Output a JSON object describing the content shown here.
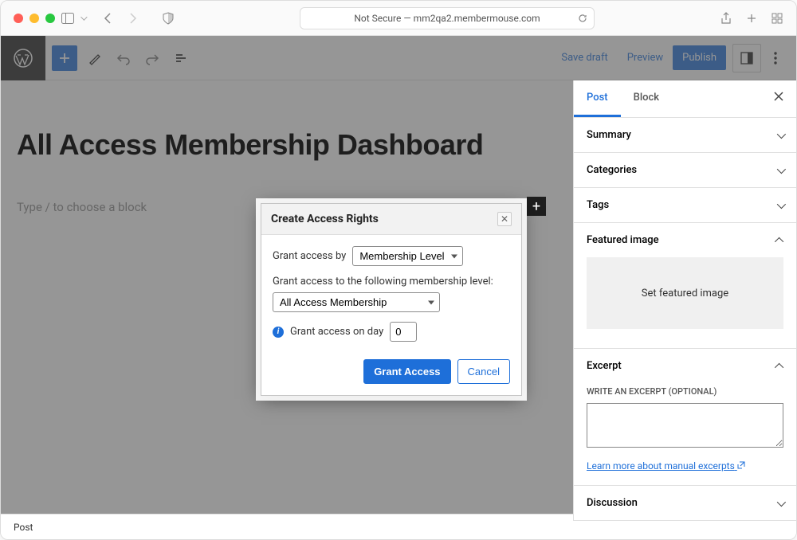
{
  "browser": {
    "url_label": "Not Secure — mm2qa2.membermouse.com"
  },
  "toolbar": {
    "save_draft": "Save draft",
    "preview": "Preview",
    "publish": "Publish"
  },
  "page": {
    "title": "All Access Membership Dashboard",
    "placeholder": "Type / to choose a block"
  },
  "sidebar": {
    "tab_post": "Post",
    "tab_block": "Block",
    "panels": {
      "summary": "Summary",
      "categories": "Categories",
      "tags": "Tags",
      "featured": "Featured image",
      "featured_button": "Set featured image",
      "excerpt": "Excerpt",
      "excerpt_label": "WRITE AN EXCERPT (OPTIONAL)",
      "excerpt_link": "Learn more about manual excerpts",
      "discussion": "Discussion"
    }
  },
  "modal": {
    "title": "Create Access Rights",
    "grant_by_label": "Grant access by",
    "grant_by_value": "Membership Level",
    "level_label": "Grant access to the following membership level:",
    "level_value": "All Access Membership",
    "day_label": "Grant access on day",
    "day_value": "0",
    "grant_button": "Grant Access",
    "cancel_button": "Cancel"
  },
  "footer": {
    "breadcrumb": "Post"
  }
}
